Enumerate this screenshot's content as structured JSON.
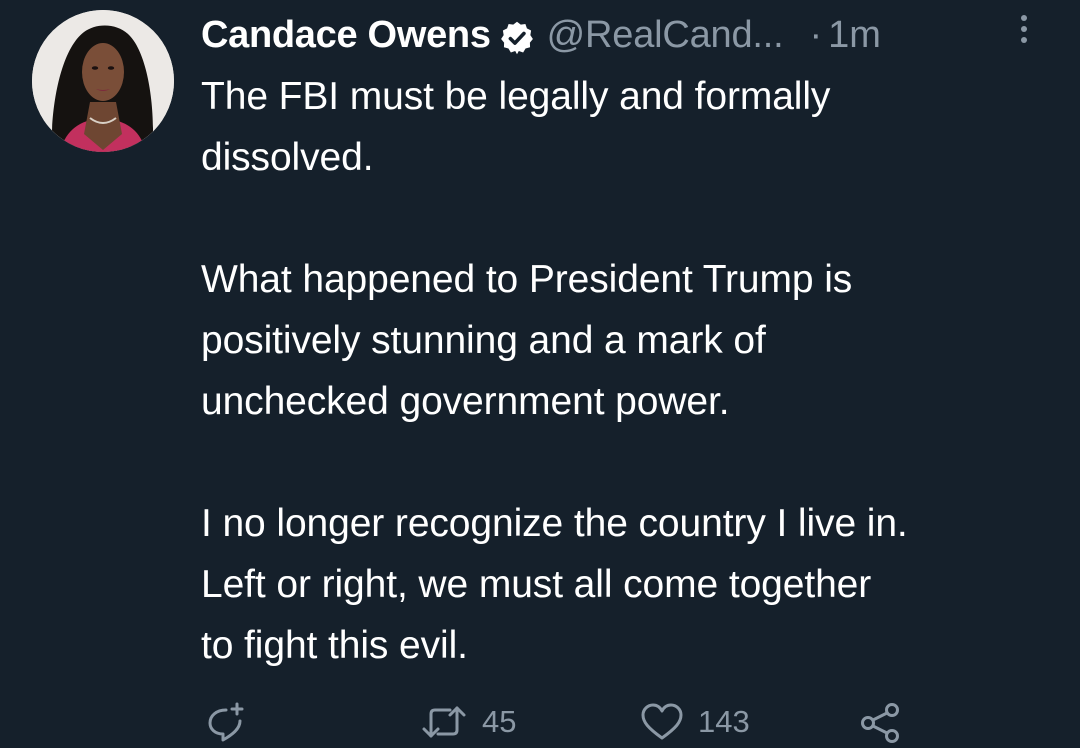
{
  "tweet": {
    "author": {
      "display_name": "Candace Owens",
      "handle": "@RealCand...",
      "verified": true
    },
    "separator": "·",
    "timestamp": "1m",
    "paragraphs": [
      [
        "The FBI must be legally and formally",
        "dissolved."
      ],
      [
        "What happened to President Trump is",
        "positively stunning and a mark of",
        "unchecked government power."
      ],
      [
        "I no longer recognize the country I live in.",
        "Left or right, we must all come together",
        "to fight this evil."
      ]
    ],
    "actions": {
      "reply_icon": "reply-icon",
      "retweet_icon": "retweet-icon",
      "retweet_count": "45",
      "like_icon": "heart-icon",
      "like_count": "143",
      "share_icon": "share-icon"
    }
  },
  "colors": {
    "background": "#15202b",
    "text_primary": "#ffffff",
    "text_secondary": "#8b98a5",
    "verified_badge": "#ffffff"
  }
}
